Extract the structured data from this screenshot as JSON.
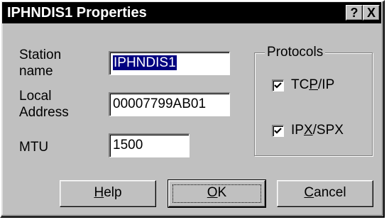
{
  "window": {
    "title": "IPHNDIS1 Properties",
    "help_button": "?",
    "close_button": "X"
  },
  "form": {
    "station_name_label_line1": "Station",
    "station_name_label_line2": "name",
    "station_name_value": "IPHNDIS1",
    "local_address_label_line1": "Local",
    "local_address_label_line2": "Address",
    "local_address_value": "00007799AB01",
    "mtu_label": "MTU",
    "mtu_value": "1500"
  },
  "protocols": {
    "legend": "Protocols",
    "items": [
      {
        "pre": "TC",
        "mnemonic": "P",
        "post": "/IP",
        "checked": true
      },
      {
        "pre": "IP",
        "mnemonic": "X",
        "post": "/SPX",
        "checked": true
      }
    ]
  },
  "buttons": {
    "help": {
      "pre": "",
      "mnemonic": "H",
      "post": "elp"
    },
    "ok": {
      "pre": "",
      "mnemonic": "O",
      "post": "K"
    },
    "cancel": {
      "pre": "",
      "mnemonic": "C",
      "post": "ancel"
    }
  },
  "colors": {
    "face": "#c0c0c0",
    "titlebar": "#000000",
    "selection": "#000080"
  }
}
